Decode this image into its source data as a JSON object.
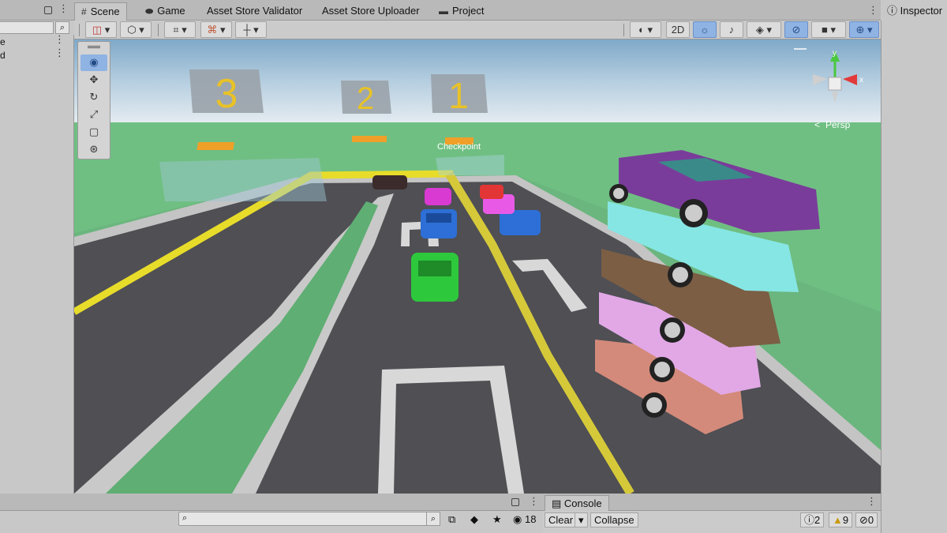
{
  "left_panel": {
    "rows": [
      {
        "label": "e"
      },
      {
        "label": "d"
      }
    ],
    "search_icon": "search-filter-icon"
  },
  "scene_tabs": [
    {
      "label": "Scene",
      "icon": "hash-grid-icon"
    },
    {
      "label": "Game",
      "icon": "gamepad-icon"
    },
    {
      "label": "Asset Store Validator"
    },
    {
      "label": "Asset Store Uploader"
    },
    {
      "label": "Project",
      "icon": "folder-icon"
    }
  ],
  "scene_toolbar": {
    "mode_2d_label": "2D"
  },
  "viewport": {
    "signs": [
      "3",
      "2",
      "1"
    ],
    "checkpoint_label": "Checkpoint",
    "persp_label": "Persp",
    "axis_labels": {
      "y": "y",
      "x": "x"
    },
    "accent_colors": {
      "sky": "#cfe0ec",
      "grass": "#6fbf82",
      "road": "#4d4d52",
      "yellow_line": "#e8dc2a"
    }
  },
  "inspector": {
    "title": "Inspector",
    "icon": "info-circle-icon"
  },
  "project": {
    "hidden_count": "18"
  },
  "console": {
    "tab_label": "Console",
    "clear_label": "Clear",
    "collapse_label": "Collapse",
    "errors_count": "0",
    "warnings_count": "9",
    "info_count": "2"
  }
}
